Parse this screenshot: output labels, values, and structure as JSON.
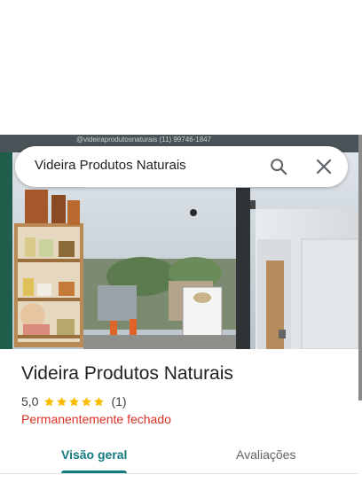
{
  "search": {
    "query": "Videira Produtos Naturais",
    "search_icon": "search-icon",
    "close_icon": "close-icon"
  },
  "photo": {
    "signage_text": "@videiraprodutosnaturais   (11) 99746-1847"
  },
  "place": {
    "name": "Videira Produtos Naturais",
    "rating": "5,0",
    "stars": 5,
    "review_count": "(1)",
    "status": "Permanentemente fechado"
  },
  "tabs": [
    {
      "label": "Visão geral",
      "selected": true
    },
    {
      "label": "Avaliações",
      "selected": false
    }
  ],
  "colors": {
    "accent": "#137a7f",
    "star": "#fbbc04",
    "closed": "#d93025"
  }
}
